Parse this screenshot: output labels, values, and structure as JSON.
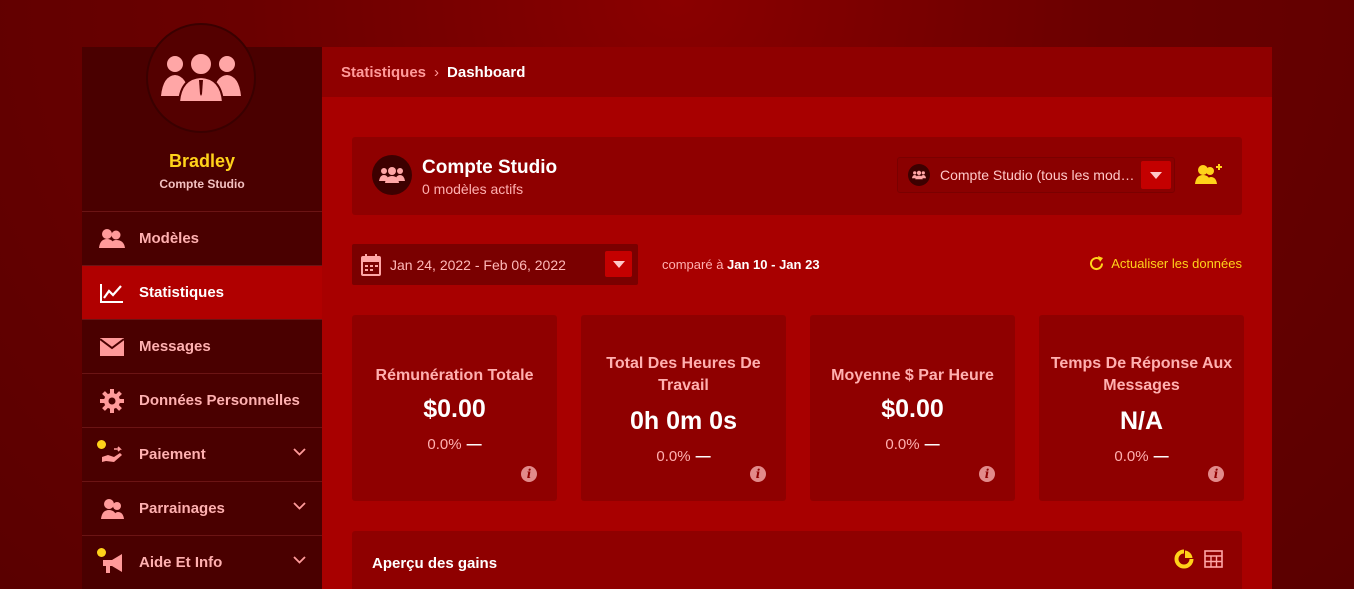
{
  "sidebar": {
    "profile": {
      "name": "Bradley",
      "role": "Compte Studio"
    },
    "items": [
      {
        "label": "Modèles",
        "icon": "users-icon",
        "active": false
      },
      {
        "label": "Statistiques",
        "icon": "chart-line-icon",
        "active": true
      },
      {
        "label": "Messages",
        "icon": "envelope-icon",
        "active": false
      },
      {
        "label": "Données Personnelles",
        "icon": "gear-icon",
        "active": false
      },
      {
        "label": "Paiement",
        "icon": "hand-money-icon",
        "active": false,
        "expandable": true
      },
      {
        "label": "Parrainages",
        "icon": "referral-icon",
        "active": false,
        "expandable": true
      },
      {
        "label": "Aide Et Info",
        "icon": "megaphone-icon",
        "active": false,
        "expandable": true
      }
    ]
  },
  "breadcrumb": {
    "parent": "Statistiques",
    "separator": "›",
    "current": "Dashboard"
  },
  "studio": {
    "title": "Compte Studio",
    "subtitle": "0 modèles actifs",
    "select_value": "Compte Studio (tous les modèles)"
  },
  "filters": {
    "date_range": "Jan 24, 2022 - Feb 06, 2022",
    "compare_label": "comparé à",
    "compare_range": "Jan 10 - Jan 23",
    "refresh_label": "Actualiser les données"
  },
  "stats": [
    {
      "title": "Rémunération Totale",
      "value": "$0.00",
      "change": "0.0%",
      "dash": "—"
    },
    {
      "title": "Total Des Heures De Travail",
      "value": "0h 0m 0s",
      "change": "0.0%",
      "dash": "—"
    },
    {
      "title": "Moyenne $ Par Heure",
      "value": "$0.00",
      "change": "0.0%",
      "dash": "—"
    },
    {
      "title": "Temps De Réponse Aux Messages",
      "value": "N/A",
      "change": "0.0%",
      "dash": "—"
    }
  ],
  "gains": {
    "title": "Aperçu des gains"
  },
  "colors": {
    "accent": "#ffd21a",
    "main_bg": "#a80000",
    "card_bg": "#8f0000",
    "sidebar_bg": "#4a0000",
    "active": "#b00000"
  }
}
